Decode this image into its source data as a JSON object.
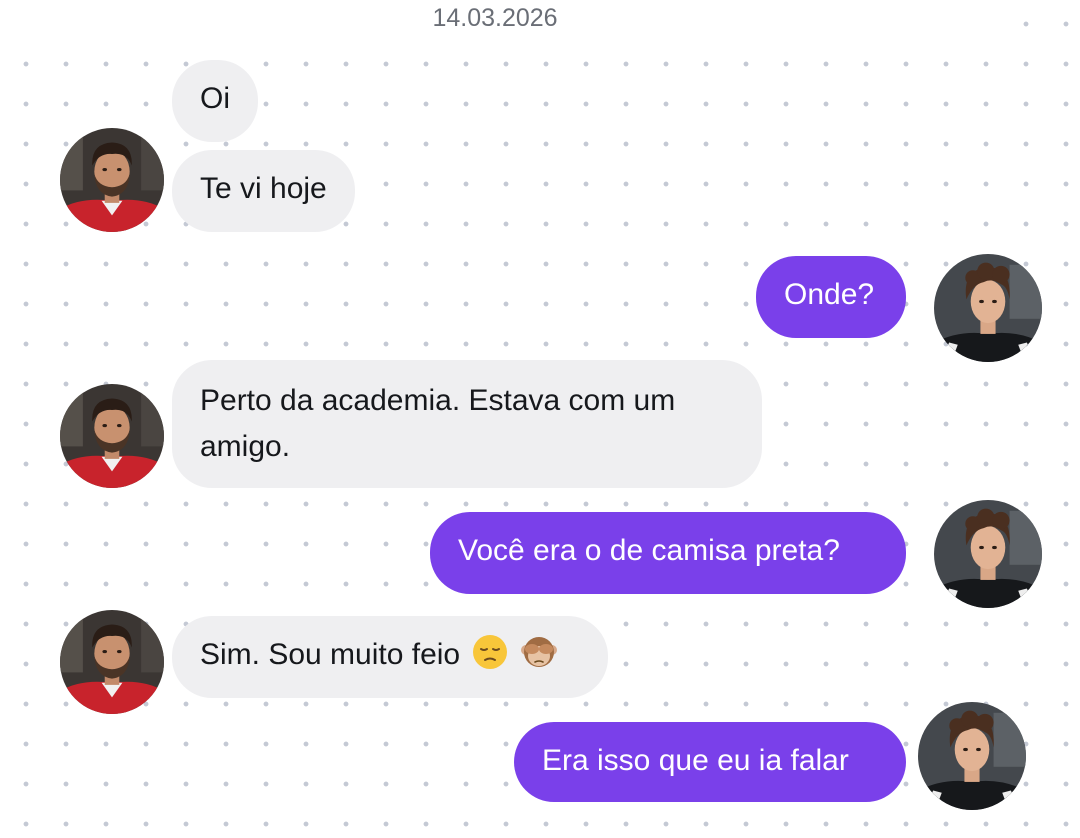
{
  "conversation": {
    "date": "14.03.2026",
    "messages": [
      {
        "sender": "contact",
        "text": "Oi"
      },
      {
        "sender": "contact",
        "text": "Te vi hoje"
      },
      {
        "sender": "me",
        "text": "Onde?"
      },
      {
        "sender": "contact",
        "line1": "Perto da academia. Estava com um",
        "line2": "amigo."
      },
      {
        "sender": "me",
        "text": "Você era o de camisa preta?"
      },
      {
        "sender": "contact",
        "text": "Sim. Sou muito feio",
        "emoji": [
          "pensive-face",
          "see-no-evil-monkey"
        ]
      },
      {
        "sender": "me",
        "text": "Era isso que eu ia falar"
      }
    ]
  },
  "colors": {
    "outgoing_bubble": "#7a40ea",
    "incoming_bubble": "#efeff1",
    "background_dots": "#c4c9d4"
  }
}
